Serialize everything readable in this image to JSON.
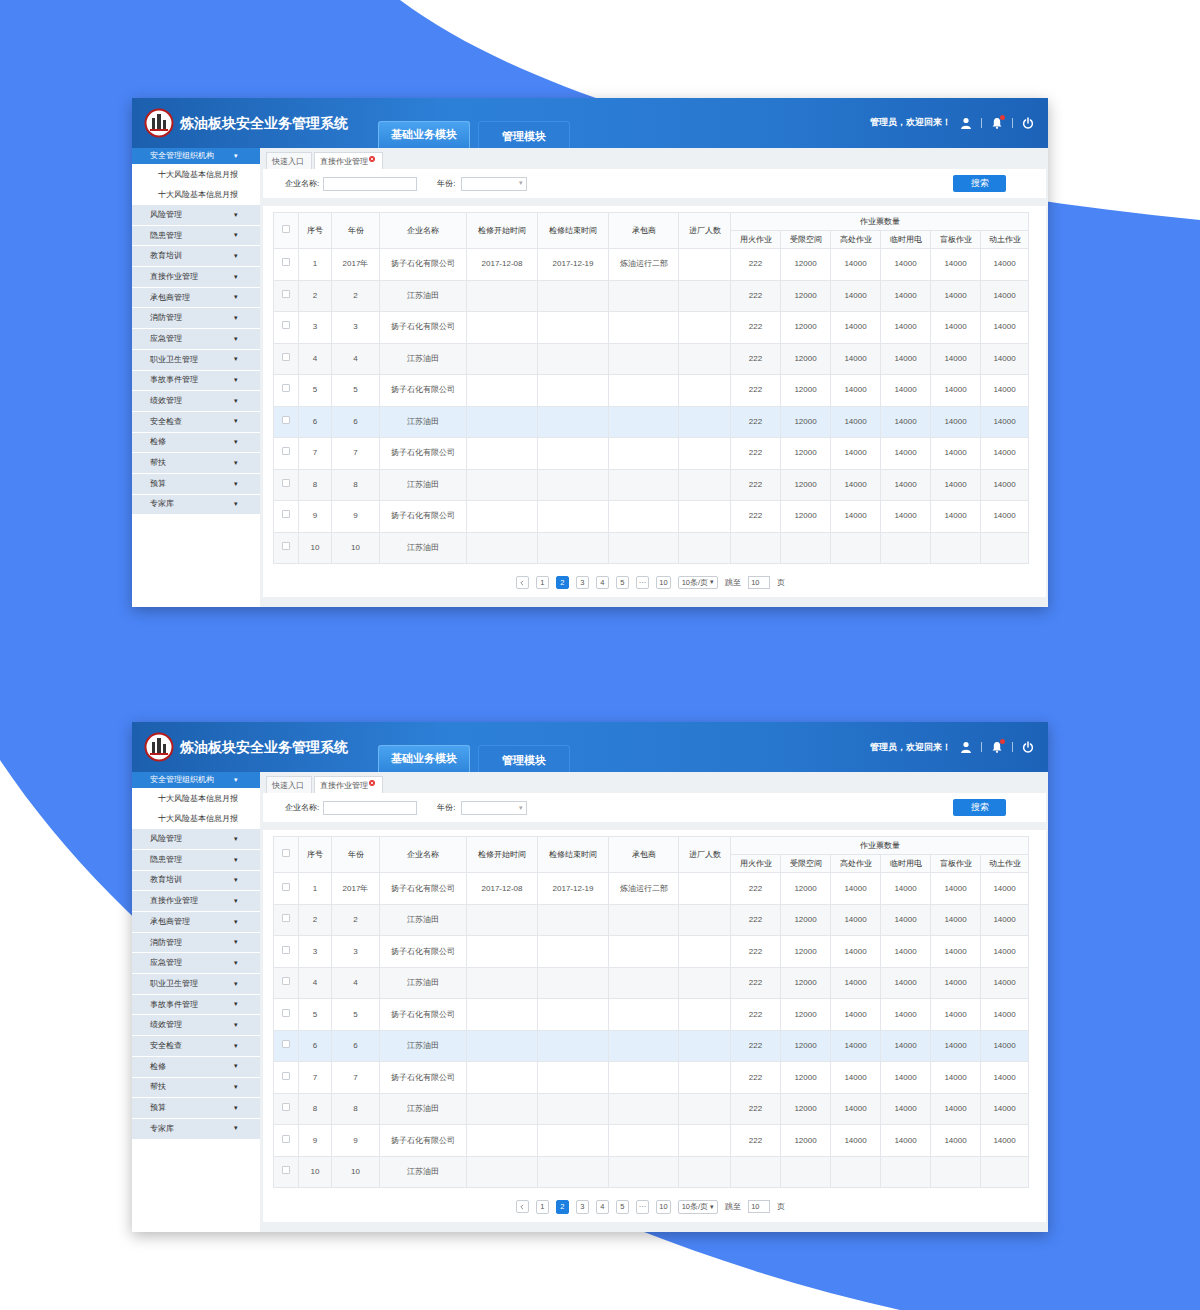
{
  "screens": [
    {
      "header": {
        "title": "炼油板块安全业务管理系统",
        "modules": [
          {
            "label": "基础业务模块",
            "selected": true
          },
          {
            "label": "管理模块",
            "selected": false
          }
        ],
        "greeting": "管理员，欢迎回来！",
        "bell_badge": true
      },
      "sidebar": {
        "caret": "▾",
        "items": [
          {
            "label": "安全管理组织机构",
            "expanded": true,
            "children": [
              {
                "label": "十大风险基本信息月报"
              },
              {
                "label": "十大风险基本信息月报"
              }
            ]
          },
          {
            "label": "风险管理",
            "expanded": false,
            "children": []
          },
          {
            "label": "隐患管理",
            "expanded": false,
            "children": []
          },
          {
            "label": "教育培训",
            "expanded": false,
            "children": []
          },
          {
            "label": "直接作业管理",
            "expanded": false,
            "children": []
          },
          {
            "label": "承包商管理",
            "expanded": false,
            "children": []
          },
          {
            "label": "消防管理",
            "expanded": false,
            "children": []
          },
          {
            "label": "应急管理",
            "expanded": false,
            "children": []
          },
          {
            "label": "职业卫生管理",
            "expanded": false,
            "children": []
          },
          {
            "label": "事故事件管理",
            "expanded": false,
            "children": []
          },
          {
            "label": "绩效管理",
            "expanded": false,
            "children": []
          },
          {
            "label": "安全检查",
            "expanded": false,
            "children": []
          },
          {
            "label": "检修",
            "expanded": false,
            "children": []
          },
          {
            "label": "帮扶",
            "expanded": false,
            "children": []
          },
          {
            "label": "预算",
            "expanded": false,
            "children": []
          },
          {
            "label": "专家库",
            "expanded": false,
            "children": []
          }
        ]
      },
      "tabs": [
        {
          "label": "快速入口",
          "selected": false,
          "closable": false
        },
        {
          "label": "直接作业管理",
          "selected": true,
          "closable": true
        }
      ],
      "filters": {
        "company_label": "企业名称:",
        "year_label": "年份:",
        "year_caret": "▾",
        "search_button": "搜索"
      },
      "table": {
        "header_checked": false,
        "columns": [
          "序号",
          "年份",
          "企业名称",
          "检修开始时间",
          "检修结束时间",
          "承包商",
          "进厂人数"
        ],
        "group": {
          "label": "作业票数量",
          "columns": [
            "用火作业",
            "受限空间",
            "高处作业",
            "临时用电",
            "盲板作业",
            "动土作业"
          ]
        },
        "rows": [
          {
            "checked": false,
            "selected": false,
            "cells": [
              "1",
              "2017年",
              "扬子石化有限公司",
              "2017-12-08",
              "2017-12-19",
              "炼油运行二部",
              "",
              "222",
              "12000",
              "14000",
              "14000",
              "14000",
              "14000"
            ]
          },
          {
            "checked": false,
            "selected": false,
            "cells": [
              "2",
              "2",
              "江苏油田",
              "",
              "",
              "",
              "",
              "222",
              "12000",
              "14000",
              "14000",
              "14000",
              "14000"
            ]
          },
          {
            "checked": false,
            "selected": false,
            "cells": [
              "3",
              "3",
              "扬子石化有限公司",
              "",
              "",
              "",
              "",
              "222",
              "12000",
              "14000",
              "14000",
              "14000",
              "14000"
            ]
          },
          {
            "checked": false,
            "selected": false,
            "cells": [
              "4",
              "4",
              "江苏油田",
              "",
              "",
              "",
              "",
              "222",
              "12000",
              "14000",
              "14000",
              "14000",
              "14000"
            ]
          },
          {
            "checked": false,
            "selected": false,
            "cells": [
              "5",
              "5",
              "扬子石化有限公司",
              "",
              "",
              "",
              "",
              "222",
              "12000",
              "14000",
              "14000",
              "14000",
              "14000"
            ]
          },
          {
            "checked": false,
            "selected": true,
            "cells": [
              "6",
              "6",
              "江苏油田",
              "",
              "",
              "",
              "",
              "222",
              "12000",
              "14000",
              "14000",
              "14000",
              "14000"
            ]
          },
          {
            "checked": false,
            "selected": false,
            "cells": [
              "7",
              "7",
              "扬子石化有限公司",
              "",
              "",
              "",
              "",
              "222",
              "12000",
              "14000",
              "14000",
              "14000",
              "14000"
            ]
          },
          {
            "checked": false,
            "selected": false,
            "cells": [
              "8",
              "8",
              "江苏油田",
              "",
              "",
              "",
              "",
              "222",
              "12000",
              "14000",
              "14000",
              "14000",
              "14000"
            ]
          },
          {
            "checked": false,
            "selected": false,
            "cells": [
              "9",
              "9",
              "扬子石化有限公司",
              "",
              "",
              "",
              "",
              "222",
              "12000",
              "14000",
              "14000",
              "14000",
              "14000"
            ]
          },
          {
            "checked": false,
            "selected": false,
            "cells": [
              "10",
              "10",
              "江苏油田",
              "",
              "",
              "",
              "",
              "",
              "",
              "",
              "",
              "",
              ""
            ]
          }
        ]
      },
      "pagination": {
        "pages": [
          {
            "label": "1",
            "selected": false
          },
          {
            "label": "2",
            "selected": true
          },
          {
            "label": "3",
            "selected": false
          },
          {
            "label": "4",
            "selected": false
          },
          {
            "label": "5",
            "selected": false
          },
          {
            "label": "···",
            "selected": false
          },
          {
            "label": "10",
            "selected": false
          }
        ],
        "page_size": "10条/页",
        "size_caret": "▾",
        "jump_label": "跳至",
        "jump_value": "10",
        "unit": "页"
      }
    },
    {
      "header": {
        "title": "炼油板块安全业务管理系统",
        "modules": [
          {
            "label": "基础业务模块",
            "selected": true
          },
          {
            "label": "管理模块",
            "selected": false
          }
        ],
        "greeting": "管理员，欢迎回来！",
        "bell_badge": true
      },
      "sidebar": {
        "caret": "▾",
        "items": [
          {
            "label": "安全管理组织机构",
            "expanded": true,
            "children": [
              {
                "label": "十大风险基本信息月报"
              },
              {
                "label": "十大风险基本信息月报"
              }
            ]
          },
          {
            "label": "风险管理",
            "expanded": false,
            "children": []
          },
          {
            "label": "隐患管理",
            "expanded": false,
            "children": []
          },
          {
            "label": "教育培训",
            "expanded": false,
            "children": []
          },
          {
            "label": "直接作业管理",
            "expanded": false,
            "children": []
          },
          {
            "label": "承包商管理",
            "expanded": false,
            "children": []
          },
          {
            "label": "消防管理",
            "expanded": false,
            "children": []
          },
          {
            "label": "应急管理",
            "expanded": false,
            "children": []
          },
          {
            "label": "职业卫生管理",
            "expanded": false,
            "children": []
          },
          {
            "label": "事故事件管理",
            "expanded": false,
            "children": []
          },
          {
            "label": "绩效管理",
            "expanded": false,
            "children": []
          },
          {
            "label": "安全检查",
            "expanded": false,
            "children": []
          },
          {
            "label": "检修",
            "expanded": false,
            "children": []
          },
          {
            "label": "帮扶",
            "expanded": false,
            "children": []
          },
          {
            "label": "预算",
            "expanded": false,
            "children": []
          },
          {
            "label": "专家库",
            "expanded": false,
            "children": []
          }
        ]
      },
      "tabs": [
        {
          "label": "快速入口",
          "selected": false,
          "closable": false
        },
        {
          "label": "直接作业管理",
          "selected": true,
          "closable": true
        }
      ],
      "filters": {
        "company_label": "企业名称:",
        "year_label": "年份:",
        "year_caret": "▾",
        "search_button": "搜索"
      },
      "table": {
        "header_checked": false,
        "columns": [
          "序号",
          "年份",
          "企业名称",
          "检修开始时间",
          "检修结束时间",
          "承包商",
          "进厂人数"
        ],
        "group": {
          "label": "作业票数量",
          "columns": [
            "用火作业",
            "受限空间",
            "高处作业",
            "临时用电",
            "盲板作业",
            "动土作业"
          ]
        },
        "rows": [
          {
            "checked": false,
            "selected": false,
            "cells": [
              "1",
              "2017年",
              "扬子石化有限公司",
              "2017-12-08",
              "2017-12-19",
              "炼油运行二部",
              "",
              "222",
              "12000",
              "14000",
              "14000",
              "14000",
              "14000"
            ]
          },
          {
            "checked": false,
            "selected": false,
            "cells": [
              "2",
              "2",
              "江苏油田",
              "",
              "",
              "",
              "",
              "222",
              "12000",
              "14000",
              "14000",
              "14000",
              "14000"
            ]
          },
          {
            "checked": false,
            "selected": false,
            "cells": [
              "3",
              "3",
              "扬子石化有限公司",
              "",
              "",
              "",
              "",
              "222",
              "12000",
              "14000",
              "14000",
              "14000",
              "14000"
            ]
          },
          {
            "checked": false,
            "selected": false,
            "cells": [
              "4",
              "4",
              "江苏油田",
              "",
              "",
              "",
              "",
              "222",
              "12000",
              "14000",
              "14000",
              "14000",
              "14000"
            ]
          },
          {
            "checked": false,
            "selected": false,
            "cells": [
              "5",
              "5",
              "扬子石化有限公司",
              "",
              "",
              "",
              "",
              "222",
              "12000",
              "14000",
              "14000",
              "14000",
              "14000"
            ]
          },
          {
            "checked": false,
            "selected": true,
            "cells": [
              "6",
              "6",
              "江苏油田",
              "",
              "",
              "",
              "",
              "222",
              "12000",
              "14000",
              "14000",
              "14000",
              "14000"
            ]
          },
          {
            "checked": false,
            "selected": false,
            "cells": [
              "7",
              "7",
              "扬子石化有限公司",
              "",
              "",
              "",
              "",
              "222",
              "12000",
              "14000",
              "14000",
              "14000",
              "14000"
            ]
          },
          {
            "checked": false,
            "selected": false,
            "cells": [
              "8",
              "8",
              "江苏油田",
              "",
              "",
              "",
              "",
              "222",
              "12000",
              "14000",
              "14000",
              "14000",
              "14000"
            ]
          },
          {
            "checked": false,
            "selected": false,
            "cells": [
              "9",
              "9",
              "扬子石化有限公司",
              "",
              "",
              "",
              "",
              "222",
              "12000",
              "14000",
              "14000",
              "14000",
              "14000"
            ]
          },
          {
            "checked": false,
            "selected": false,
            "cells": [
              "10",
              "10",
              "江苏油田",
              "",
              "",
              "",
              "",
              "",
              "",
              "",
              "",
              "",
              ""
            ]
          }
        ]
      },
      "pagination": {
        "pages": [
          {
            "label": "1",
            "selected": false
          },
          {
            "label": "2",
            "selected": true
          },
          {
            "label": "3",
            "selected": false
          },
          {
            "label": "4",
            "selected": false
          },
          {
            "label": "5",
            "selected": false
          },
          {
            "label": "···",
            "selected": false
          },
          {
            "label": "10",
            "selected": false
          }
        ],
        "page_size": "10条/页",
        "size_caret": "▾",
        "jump_label": "跳至",
        "jump_value": "10",
        "unit": "页"
      }
    }
  ]
}
